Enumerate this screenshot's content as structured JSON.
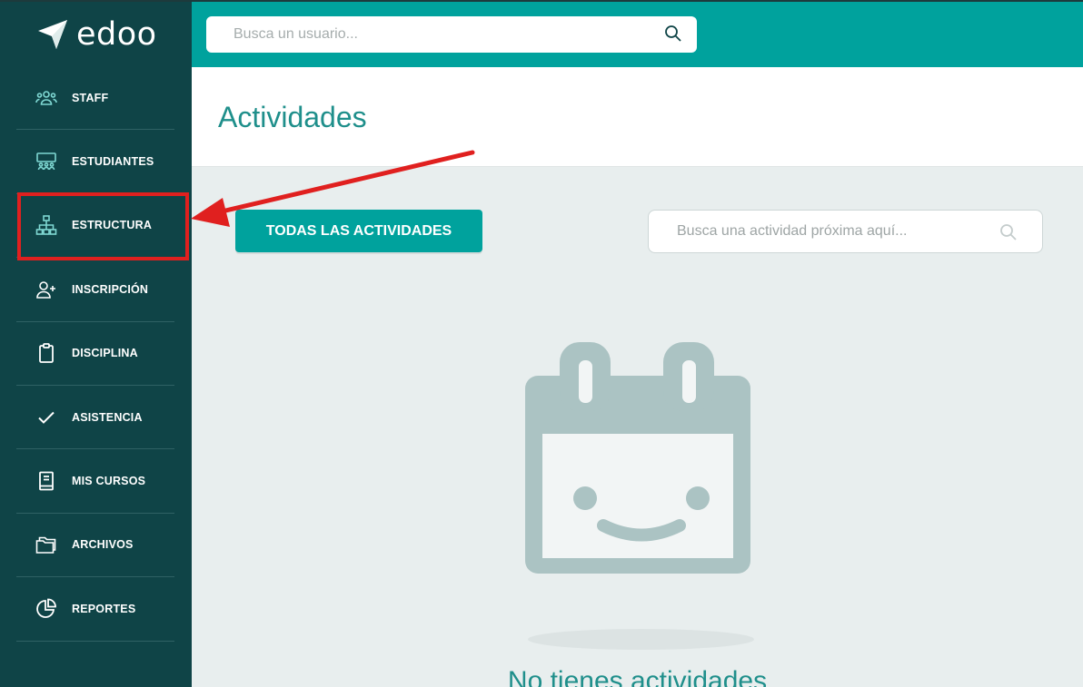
{
  "brand": {
    "name": "edoo"
  },
  "sidebar": {
    "items": [
      {
        "label": "STAFF",
        "icon": "staff-icon"
      },
      {
        "label": "ESTUDIANTES",
        "icon": "students-icon"
      },
      {
        "label": "ESTRUCTURA",
        "icon": "structure-icon"
      },
      {
        "label": "INSCRIPCIÓN",
        "icon": "add-user-icon"
      },
      {
        "label": "DISCIPLINA",
        "icon": "clipboard-icon"
      },
      {
        "label": "ASISTENCIA",
        "icon": "check-icon"
      },
      {
        "label": "MIS CURSOS",
        "icon": "book-icon"
      },
      {
        "label": "ARCHIVOS",
        "icon": "folder-icon"
      },
      {
        "label": "REPORTES",
        "icon": "pie-chart-icon"
      }
    ]
  },
  "topbar": {
    "search_placeholder": "Busca un usuario..."
  },
  "page": {
    "title": "Actividades",
    "all_button_label": "TODAS LAS ACTIVIDADES",
    "activity_search_placeholder": "Busca una actividad próxima aquí...",
    "empty_message": "No tienes actividades"
  },
  "colors": {
    "sidebar_bg": "#0f4447",
    "accent": "#00a29d",
    "title_text": "#1f8f8b",
    "annotation_red": "#e0201f",
    "sidebar_icon": "#7fd8d3"
  }
}
